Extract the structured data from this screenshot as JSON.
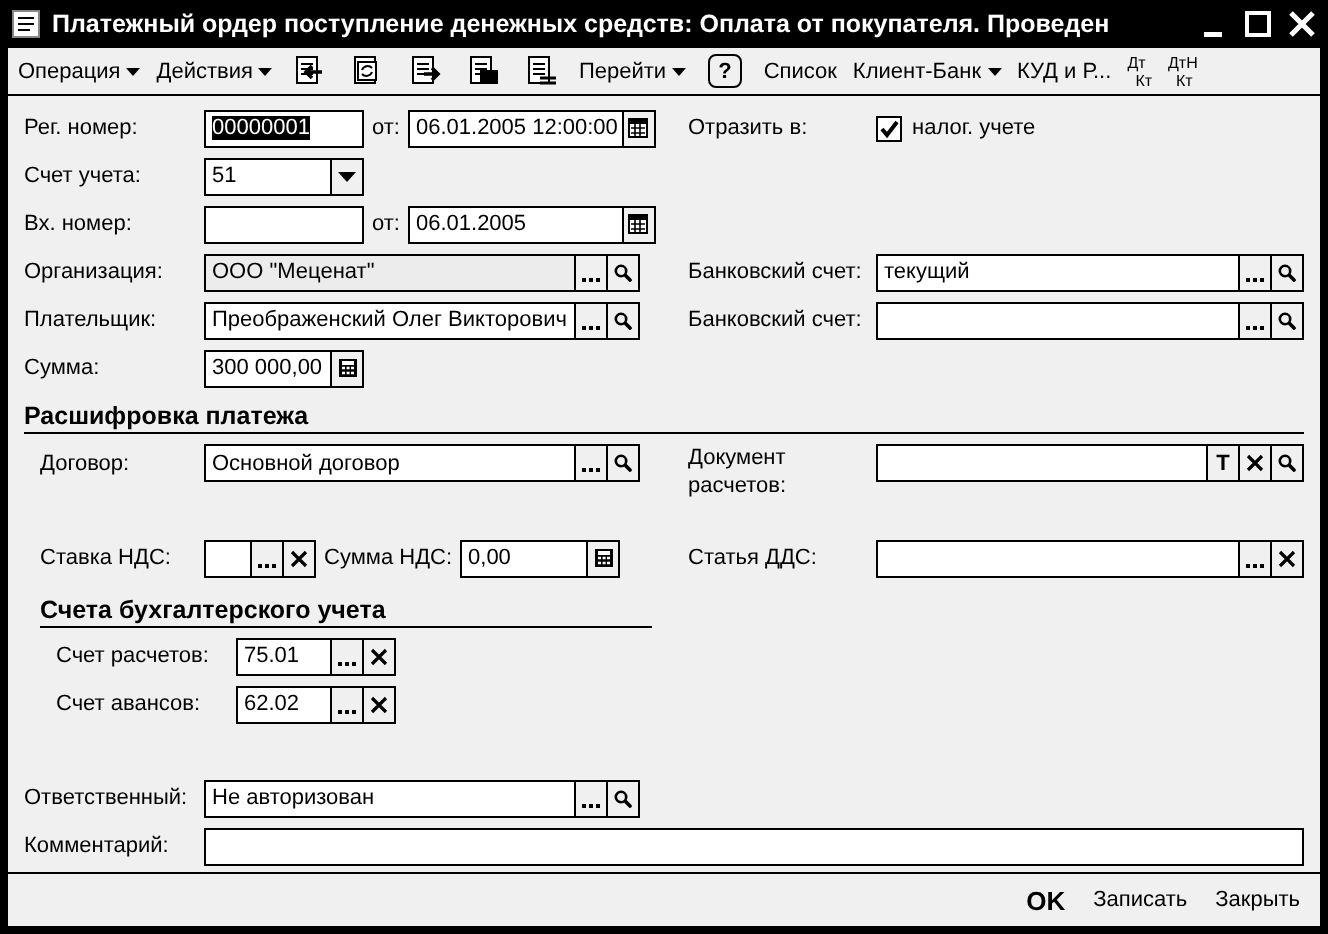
{
  "window": {
    "title": "Платежный ордер поступление денежных средств: Оплата от покупателя. Проведен"
  },
  "toolbar": [
    {
      "kind": "menu",
      "label": "Операция"
    },
    {
      "kind": "menu",
      "label": "Действия"
    },
    {
      "kind": "icon"
    },
    {
      "kind": "icon"
    },
    {
      "kind": "icon"
    },
    {
      "kind": "icon"
    },
    {
      "kind": "icon"
    },
    {
      "kind": "menu",
      "label": "Перейти"
    },
    {
      "kind": "help",
      "label": "?"
    },
    {
      "kind": "button",
      "label": "Список"
    },
    {
      "kind": "menu",
      "label": "Клиент-Банк"
    },
    {
      "kind": "button",
      "label": "КУД и Р..."
    },
    {
      "kind": "stack",
      "top": "Дт",
      "bottom": "Кт"
    },
    {
      "kind": "stack",
      "top": "ДтН",
      "bottom": "Кт"
    }
  ],
  "header": {
    "reg": {
      "label": "Рег. номер:",
      "value": "00000001",
      "value_selected": true,
      "date": {
        "label": "от:",
        "value": "06.01.2005 12:00:00",
        "buttons": [
          {
            "kind": "calendar"
          }
        ]
      }
    },
    "reflect": {
      "label": "Отразить в:",
      "checkbox_label": "налог. учете",
      "checked": true
    },
    "account": {
      "label": "Счет учета:",
      "value": "51",
      "buttons": [
        {
          "kind": "dropdown"
        }
      ]
    },
    "incoming": {
      "label": "Вх. номер:",
      "date": {
        "label": "от:",
        "value": "06.01.2005",
        "buttons": [
          {
            "kind": "calendar"
          }
        ]
      }
    },
    "organization": {
      "label": "Организация:",
      "value": "ООО \"Меценат\"",
      "readonly": true,
      "buttons": [
        {
          "kind": "select"
        },
        {
          "kind": "open"
        }
      ]
    },
    "bank_account_1": {
      "label": "Банковский счет:",
      "value": "текущий",
      "buttons": [
        {
          "kind": "select"
        },
        {
          "kind": "open"
        }
      ]
    },
    "payer": {
      "label": "Плательщик:",
      "value": "Преображенский Олег Викторович",
      "buttons": [
        {
          "kind": "select"
        },
        {
          "kind": "open"
        }
      ]
    },
    "bank_account_2": {
      "label": "Банковский счет:",
      "buttons": [
        {
          "kind": "select"
        },
        {
          "kind": "open"
        }
      ]
    },
    "amount": {
      "label": "Сумма:",
      "value": "300 000,00",
      "buttons": [
        {
          "kind": "calc"
        }
      ]
    }
  },
  "payment": {
    "title": "Расшифровка платежа",
    "contract": {
      "label": "Договор:",
      "value": "Основной договор",
      "buttons": [
        {
          "kind": "select"
        },
        {
          "kind": "open"
        }
      ]
    },
    "document": {
      "label": "Документ расчетов:",
      "buttons": [
        {
          "kind": "text",
          "label": "T"
        },
        {
          "kind": "clear"
        },
        {
          "kind": "open"
        }
      ]
    },
    "vat_rate": {
      "label": "Ставка НДС:",
      "buttons": [
        {
          "kind": "select"
        },
        {
          "kind": "clear"
        }
      ]
    },
    "vat_sum": {
      "label": "Сумма НДС:",
      "value": "0,00",
      "buttons": [
        {
          "kind": "calc"
        }
      ]
    },
    "dds": {
      "label": "Статья ДДС:",
      "buttons": [
        {
          "kind": "select"
        },
        {
          "kind": "clear"
        }
      ]
    }
  },
  "accounts": {
    "title": "Счета бухгалтерского учета",
    "settlement": {
      "label": "Счет расчетов:",
      "value": "75.01",
      "buttons": [
        {
          "kind": "select"
        },
        {
          "kind": "clear"
        }
      ]
    },
    "advance": {
      "label": "Счет авансов:",
      "value": "62.02",
      "buttons": [
        {
          "kind": "select"
        },
        {
          "kind": "clear"
        }
      ]
    }
  },
  "responsible": {
    "label": "Ответственный:",
    "value": "Не авторизован",
    "buttons": [
      {
        "kind": "select"
      },
      {
        "kind": "open"
      }
    ]
  },
  "comment": {
    "label": "Комментарий:"
  },
  "footer": [
    {
      "kind": "default",
      "label": "OK"
    },
    {
      "kind": "plain",
      "label": "Записать"
    },
    {
      "kind": "plain",
      "label": "Закрыть"
    }
  ]
}
